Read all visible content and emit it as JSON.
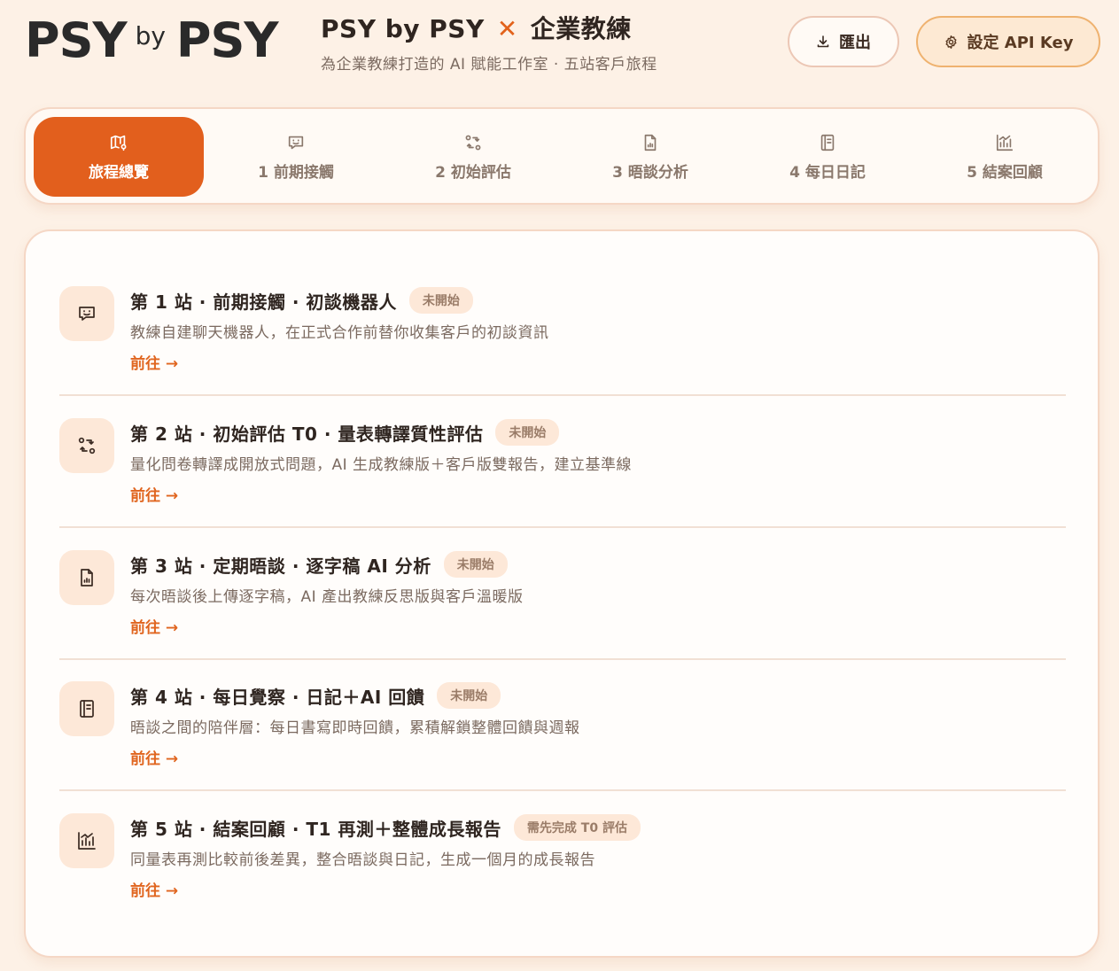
{
  "header": {
    "logo": {
      "left": "PSY",
      "by": "by",
      "right": "PSY"
    },
    "title_main": "PSY by PSY",
    "title_x": "✕",
    "title_suffix": "企業教練",
    "subtitle": "為企業教練打造的 AI 賦能工作室 · 五站客戶旅程",
    "export_label": "匯出",
    "api_label": "設定 API Key"
  },
  "tabs": [
    {
      "label": "旅程總覽",
      "icon": "map-icon",
      "active": true
    },
    {
      "label": "1 前期接觸",
      "icon": "chat-icon",
      "active": false
    },
    {
      "label": "2 初始評估",
      "icon": "swap-icon",
      "active": false
    },
    {
      "label": "3 晤談分析",
      "icon": "file-chart-icon",
      "active": false
    },
    {
      "label": "4 每日日記",
      "icon": "notebook-icon",
      "active": false
    },
    {
      "label": "5 結案回顧",
      "icon": "growth-chart-icon",
      "active": false
    }
  ],
  "stations": [
    {
      "title": "第 1 站 · 前期接觸 · 初談機器人",
      "badge": "未開始",
      "desc": "教練自建聊天機器人，在正式合作前替你收集客戶的初談資訊",
      "link": "前往 →",
      "icon": "chat-icon"
    },
    {
      "title": "第 2 站 · 初始評估 T0 · 量表轉譯質性評估",
      "badge": "未開始",
      "desc": "量化問卷轉譯成開放式問題，AI 生成教練版＋客戶版雙報告，建立基準線",
      "link": "前往 →",
      "icon": "swap-icon"
    },
    {
      "title": "第 3 站 · 定期晤談 · 逐字稿 AI 分析",
      "badge": "未開始",
      "desc": "每次晤談後上傳逐字稿，AI 產出教練反思版與客戶溫暖版",
      "link": "前往 →",
      "icon": "file-chart-icon"
    },
    {
      "title": "第 4 站 · 每日覺察 · 日記＋AI 回饋",
      "badge": "未開始",
      "desc": "晤談之間的陪伴層：每日書寫即時回饋，累積解鎖整體回饋與週報",
      "link": "前往 →",
      "icon": "notebook-icon"
    },
    {
      "title": "第 5 站 · 結案回顧 · T1 再測＋整體成長報告",
      "badge": "需先完成 T0 評估",
      "desc": "同量表再測比較前後差異，整合晤談與日記，生成一個月的成長報告",
      "link": "前往 →",
      "icon": "growth-chart-icon"
    }
  ],
  "colors": {
    "accent": "#e25f1d",
    "background": "#fdf1e6",
    "logo_blue": "#2f8fd8"
  }
}
